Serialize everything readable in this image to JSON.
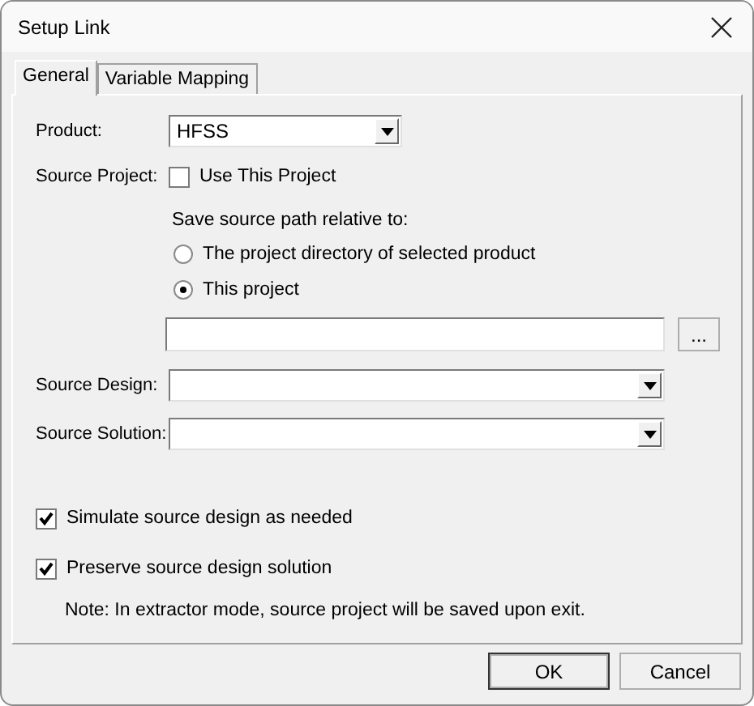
{
  "window": {
    "title": "Setup Link"
  },
  "tabs": [
    {
      "label": "General",
      "selected": true
    },
    {
      "label": "Variable Mapping",
      "selected": false
    }
  ],
  "product": {
    "label": "Product:",
    "value": "HFSS"
  },
  "source_project": {
    "label": "Source Project:",
    "use_this_project": {
      "label": "Use This Project",
      "checked": false
    }
  },
  "save_path": {
    "label": "Save source path relative to:",
    "options": [
      {
        "label": "The project directory of selected product",
        "selected": false
      },
      {
        "label": "This project",
        "selected": true
      }
    ],
    "browse": "..."
  },
  "source_design": {
    "label": "Source Design:"
  },
  "source_solution": {
    "label": "Source Solution:"
  },
  "options": [
    {
      "label": "Simulate source design as needed",
      "checked": true
    },
    {
      "label": "Preserve source design solution",
      "checked": true
    }
  ],
  "note": "Note: In extractor mode, source project will be saved upon exit.",
  "buttons": [
    {
      "label": "OK",
      "default": true
    },
    {
      "label": "Cancel",
      "default": false
    }
  ]
}
